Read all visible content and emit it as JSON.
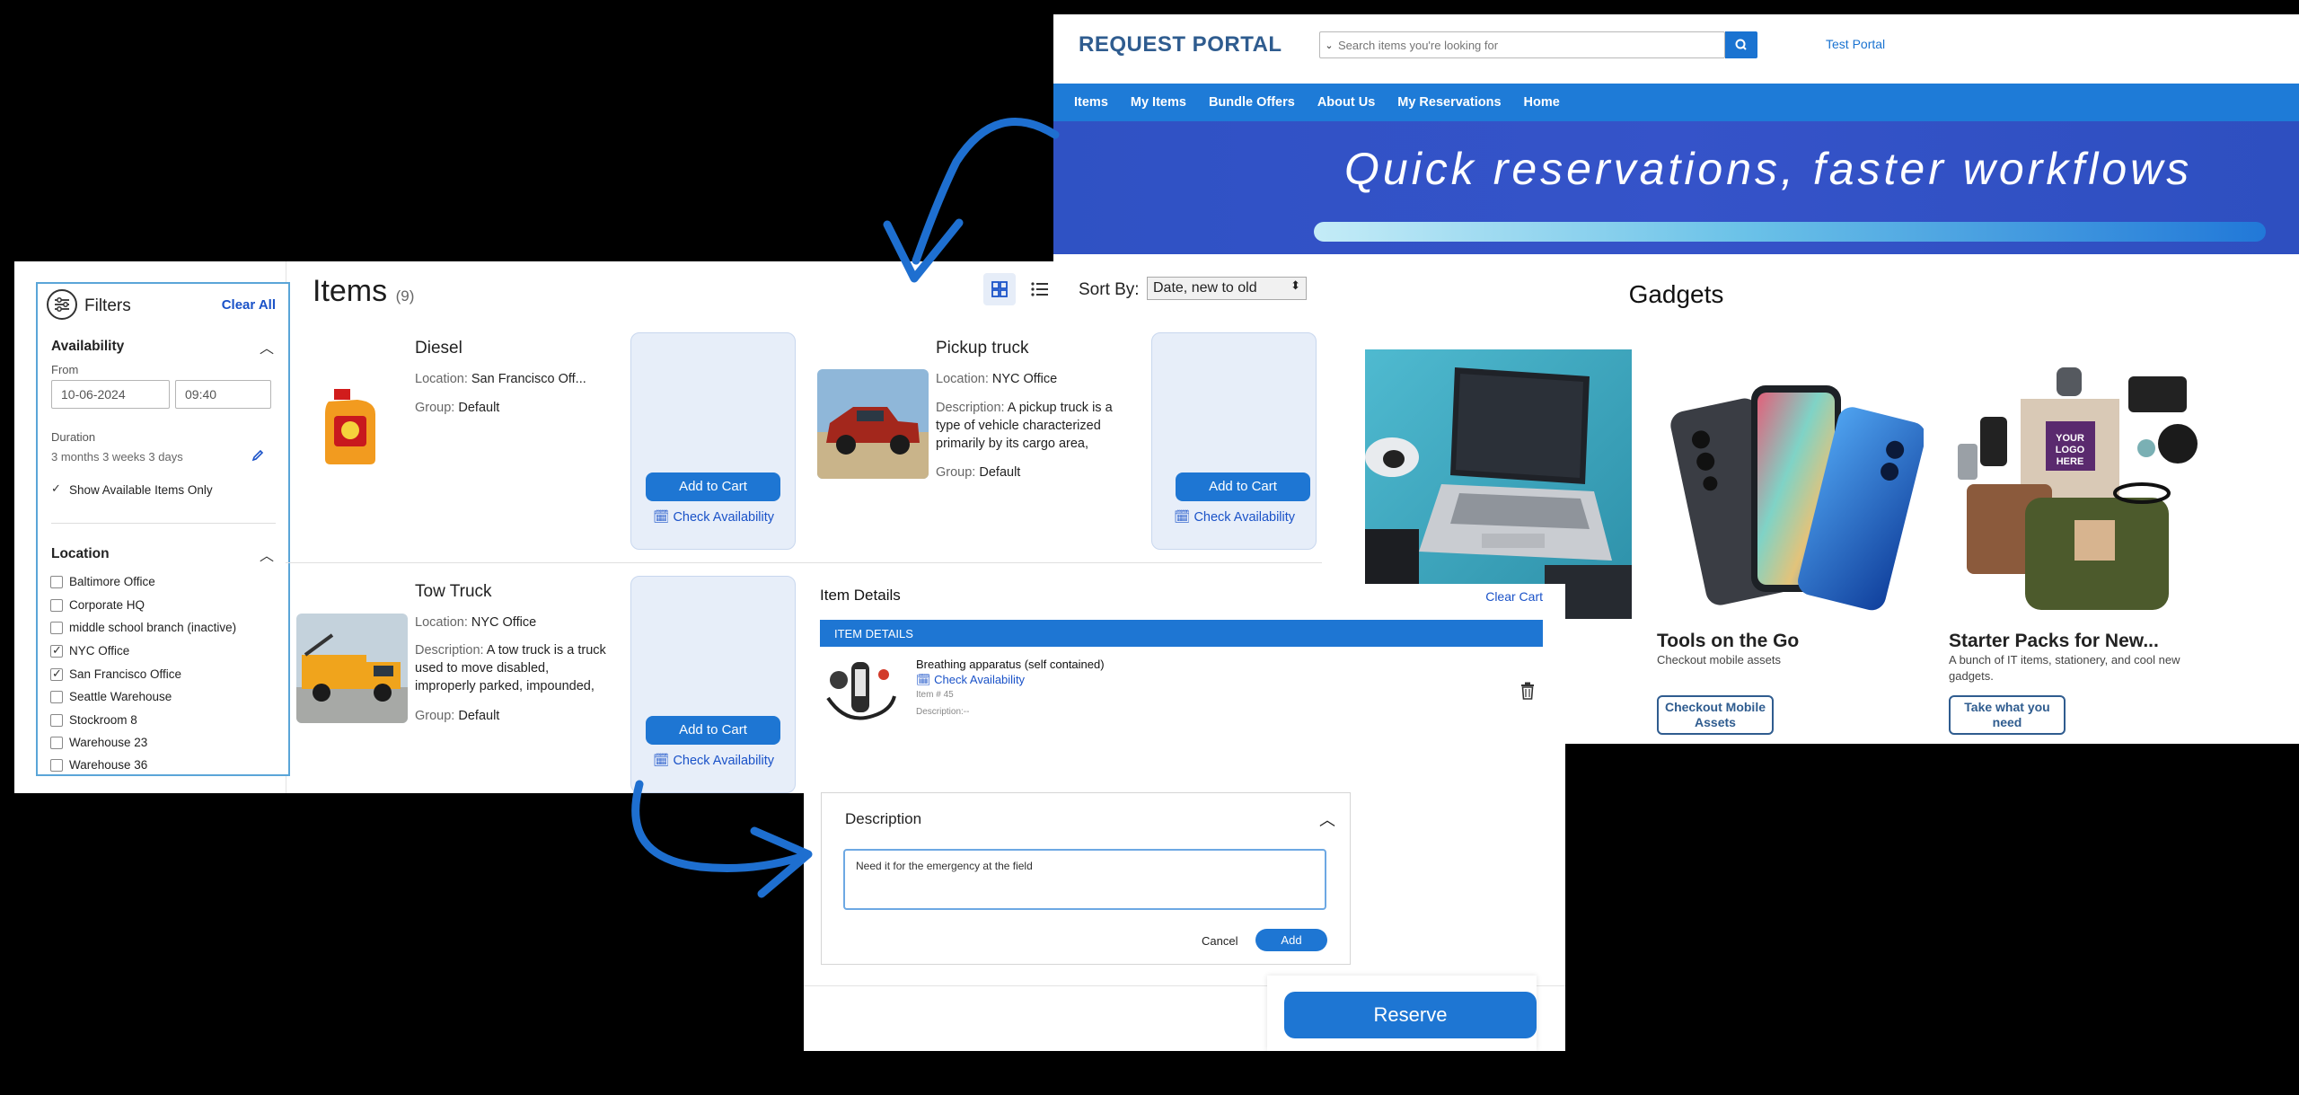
{
  "portal": {
    "logo": "REQUEST PORTAL",
    "search_placeholder": "Search items you're looking for",
    "test_portal": "Test Portal",
    "nav": [
      "Items",
      "My Items",
      "Bundle Offers",
      "About Us",
      "My Reservations",
      "Home"
    ],
    "banner_title": "Quick reservations, faster workflows",
    "section_title": "Gadgets",
    "cards": [
      {
        "title": "Tools on the Go",
        "desc": "Checkout mobile assets",
        "button": "Checkout Mobile Assets"
      },
      {
        "title": "Starter Packs for New...",
        "desc": "A bunch of IT items, stationery, and cool new gadgets.",
        "button": "Take what you need"
      }
    ],
    "logo_art_text": "YOUR LOGO HERE"
  },
  "items_page": {
    "title": "Items",
    "count": "(9)",
    "sort_label": "Sort By:",
    "sort_value": "Date, new to old",
    "filters": {
      "title": "Filters",
      "clear_all": "Clear All",
      "availability": "Availability",
      "from_label": "From",
      "from_date": "10-06-2024",
      "from_time": "09:40",
      "duration_label": "Duration",
      "duration_value": "3 months 3 weeks 3 days",
      "show_available": "Show Available Items Only",
      "location": "Location",
      "locations": [
        {
          "name": "Baltimore Office",
          "checked": false
        },
        {
          "name": "Corporate HQ",
          "checked": false
        },
        {
          "name": "middle school branch (inactive)",
          "checked": false
        },
        {
          "name": "NYC Office",
          "checked": true
        },
        {
          "name": "San Francisco Office",
          "checked": true
        },
        {
          "name": "Seattle Warehouse",
          "checked": false
        },
        {
          "name": "Stockroom 8",
          "checked": false
        },
        {
          "name": "Warehouse 23",
          "checked": false
        },
        {
          "name": "Warehouse 36",
          "checked": false
        }
      ]
    },
    "labels": {
      "location": "Location:",
      "group": "Group:",
      "description": "Description:",
      "add_to_cart": "Add to Cart",
      "check_availability": "Check Availability"
    },
    "items": [
      {
        "name": "Diesel",
        "location": "San Francisco Off...",
        "group": "Default"
      },
      {
        "name": "Pickup truck",
        "location": "NYC Office",
        "description": "A pickup truck is a type of vehicle characterized primarily by its cargo area,",
        "group": "Default"
      },
      {
        "name": "Tow Truck",
        "location": "NYC Office",
        "description": "A tow truck is a truck used to move disabled, improperly parked, impounded,",
        "group": "Default"
      }
    ]
  },
  "details": {
    "title": "Item Details",
    "clear_cart": "Clear Cart",
    "bar": "ITEM DETAILS",
    "item_name": "Breathing apparatus (self contained)",
    "check_availability": "Check Availability",
    "item_no": "Item # 45",
    "description_small": "Description:--",
    "desc_heading": "Description",
    "desc_text": "Need it for the emergency at the field",
    "cancel": "Cancel",
    "add": "Add",
    "reserve": "Reserve"
  },
  "colors": {
    "accent": "#1e76d3",
    "brand": "#2f5c8f",
    "banner": "#3553c9",
    "link": "#1a52c8"
  }
}
